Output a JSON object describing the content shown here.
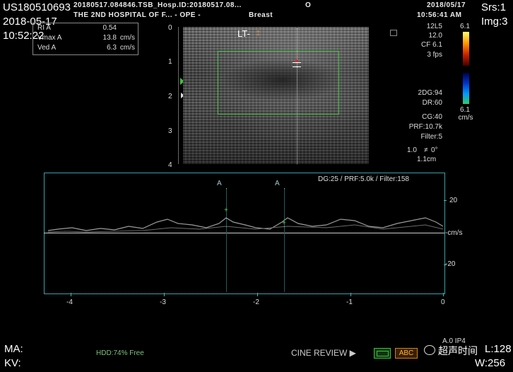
{
  "patient": {
    "id": "US180510693",
    "date": "2018-05-17",
    "time": "10:52:22"
  },
  "header": {
    "line1": "20180517.084846.TSB_Hosp.ID:20180517.08...",
    "line1_mark": "O",
    "line2": "THE 2ND HOSPITAL OF F... - OPE -",
    "line2_exam": "Breast",
    "sys_date": "2018/05/17",
    "sys_time": "10:56:41 AM",
    "srs": "Srs:1",
    "img": "Img:3"
  },
  "measurements": [
    {
      "label": "RI A",
      "value": "0.54",
      "unit": ""
    },
    {
      "label": "Vmax A",
      "value": "13.8",
      "unit": "cm/s"
    },
    {
      "label": "Ved A",
      "value": "6.3",
      "unit": "cm/s"
    }
  ],
  "image_label": "LT-",
  "depth_scale": [
    "0",
    "1",
    "2",
    "3",
    "4"
  ],
  "params_right": [
    "12L5",
    "12.0",
    "CF 6.1",
    "3 fps"
  ],
  "color_scale_top": "6.1",
  "color_scale_bottom": "6.1",
  "color_scale_unit": "cm/s",
  "params_2d": [
    "2DG:94",
    "DR:60",
    "CG:40",
    "PRF:10.7k",
    "Filter:5"
  ],
  "angle": {
    "left": "1.0",
    "right": "0°"
  },
  "gate_size": "1.1cm",
  "spectral": {
    "params": "DG:25 /   PRF:5.0k  / Filter:158",
    "y_labels": [
      "20",
      "-cm/s",
      "-20"
    ],
    "x_labels": [
      "-4",
      "-3",
      "-2",
      "-1",
      "0"
    ],
    "markers": [
      "A",
      "A"
    ]
  },
  "footer": {
    "ma": "MA:",
    "kv": "KV:",
    "hdd": "HDD:74% Free",
    "cine": "CINE REVIEW ▶",
    "abc": "ABC",
    "probe_info": "A.0  IP4",
    "watermark": "超声时间",
    "l": "L:128",
    "w": "W:256"
  },
  "colors": {
    "box_green": "#3fbf3f",
    "axis_teal": "#3aa0a8",
    "abc_orange": "#d08020"
  }
}
